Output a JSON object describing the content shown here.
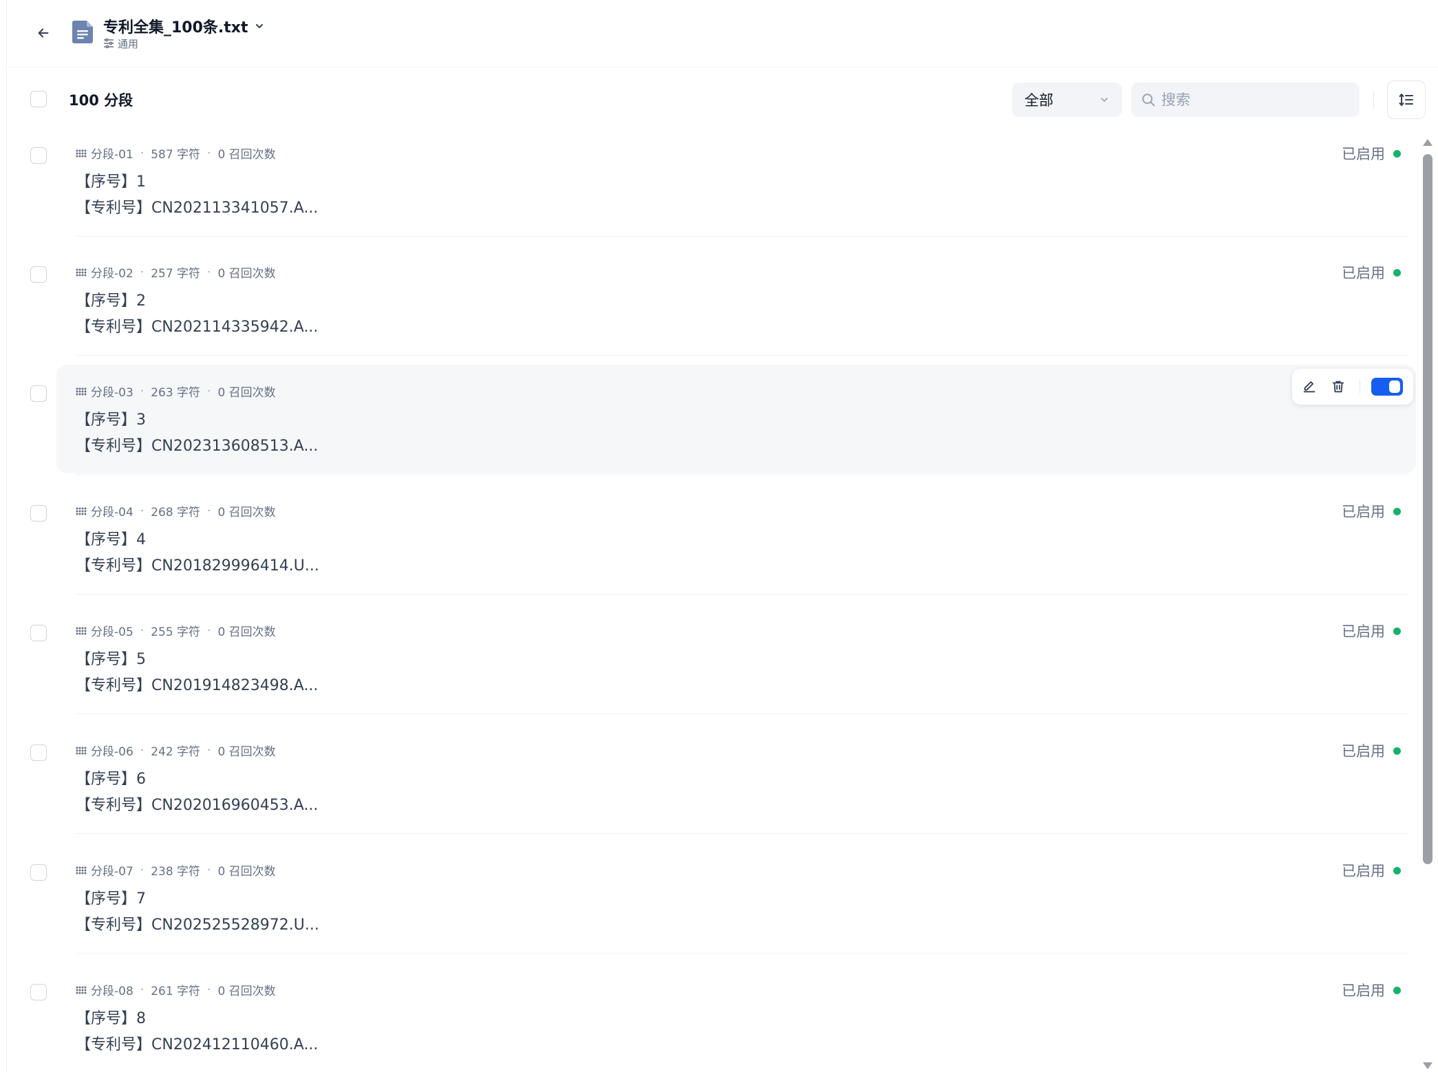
{
  "header": {
    "file_name": "专利全集_100条.txt",
    "mode_label": "通用"
  },
  "toolbar": {
    "segment_count": "100 分段",
    "filter": {
      "selected": "全部"
    },
    "search": {
      "placeholder": "搜索",
      "value": ""
    }
  },
  "colors": {
    "accent": "#155eef",
    "enabled": "#17b26a",
    "hover_bg": "#f6f7f9"
  },
  "segments": [
    {
      "id": "分段-01",
      "chars": "587 字符",
      "recalls": "0 召回次数",
      "line1": "【序号】1",
      "line2": "【专利号】CN202113341057.A...",
      "status": "已启用",
      "hovered": false
    },
    {
      "id": "分段-02",
      "chars": "257 字符",
      "recalls": "0 召回次数",
      "line1": "【序号】2",
      "line2": "【专利号】CN202114335942.A...",
      "status": "已启用",
      "hovered": false
    },
    {
      "id": "分段-03",
      "chars": "263 字符",
      "recalls": "0 召回次数",
      "line1": "【序号】3",
      "line2": "【专利号】CN202313608513.A...",
      "status": "",
      "hovered": true,
      "enabled": true
    },
    {
      "id": "分段-04",
      "chars": "268 字符",
      "recalls": "0 召回次数",
      "line1": "【序号】4",
      "line2": "【专利号】CN201829996414.U...",
      "status": "已启用",
      "hovered": false
    },
    {
      "id": "分段-05",
      "chars": "255 字符",
      "recalls": "0 召回次数",
      "line1": "【序号】5",
      "line2": "【专利号】CN201914823498.A...",
      "status": "已启用",
      "hovered": false
    },
    {
      "id": "分段-06",
      "chars": "242 字符",
      "recalls": "0 召回次数",
      "line1": "【序号】6",
      "line2": "【专利号】CN202016960453.A...",
      "status": "已启用",
      "hovered": false
    },
    {
      "id": "分段-07",
      "chars": "238 字符",
      "recalls": "0 召回次数",
      "line1": "【序号】7",
      "line2": "【专利号】CN202525528972.U...",
      "status": "已启用",
      "hovered": false
    },
    {
      "id": "分段-08",
      "chars": "261 字符",
      "recalls": "0 召回次数",
      "line1": "【序号】8",
      "line2": "【专利号】CN202412110460.A...",
      "status": "已启用",
      "hovered": false
    }
  ]
}
